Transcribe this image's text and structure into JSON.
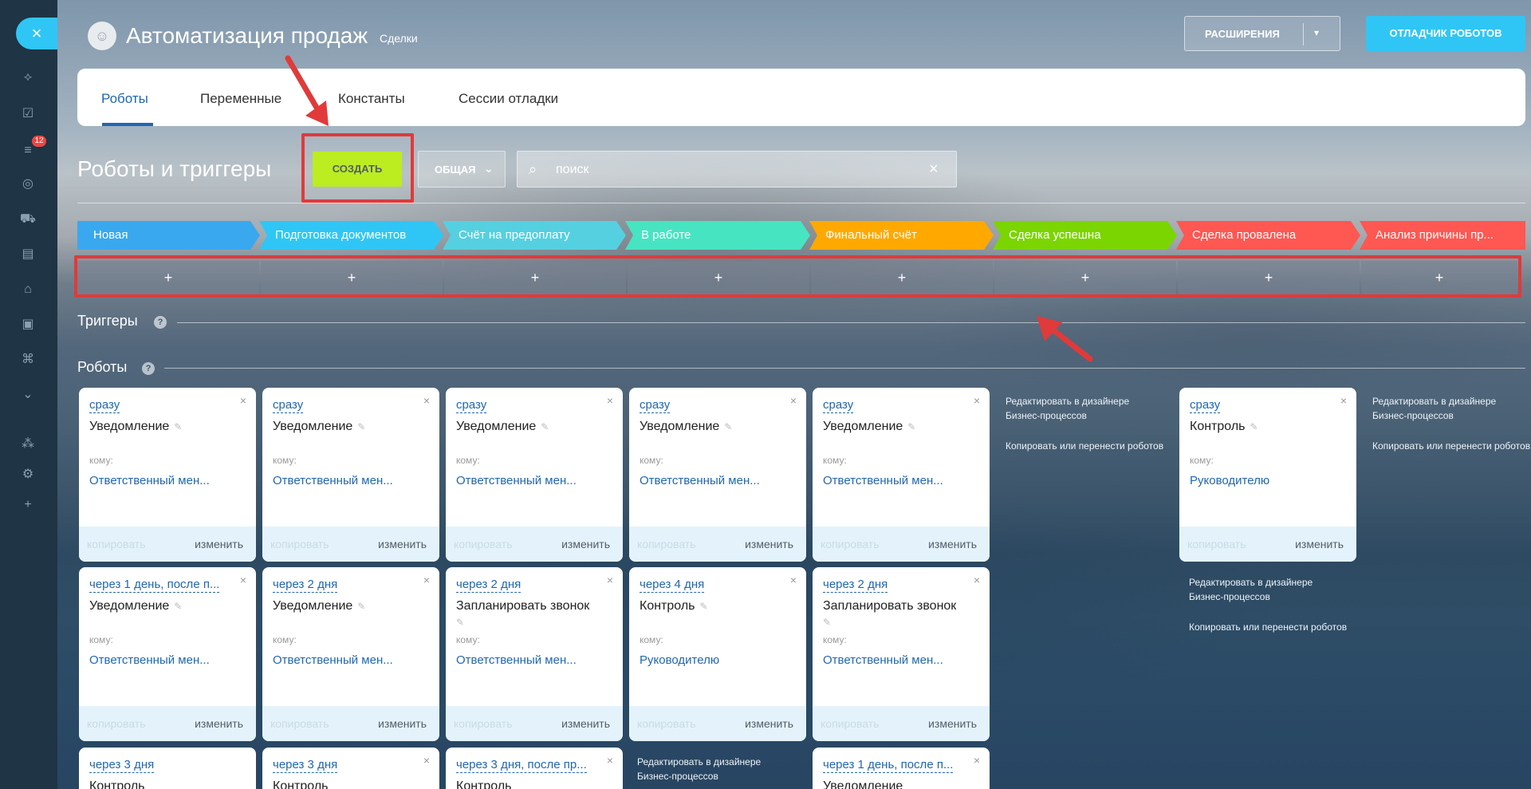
{
  "sidebar": {
    "close_label": "×",
    "badge": "12",
    "icons": [
      "share-icon",
      "task-icon",
      "filter-icon",
      "target-icon",
      "cart-icon",
      "contact-icon",
      "robot-icon",
      "box-icon",
      "store-icon",
      "chevron-down-icon",
      "sitemap-icon",
      "gear-icon",
      "plus-icon"
    ]
  },
  "header": {
    "title": "Автоматизация продаж",
    "crumb": "Сделки",
    "extensions_label": "РАСШИРЕНИЯ",
    "debugger_label": "ОТЛАДЧИК РОБОТОВ"
  },
  "tabs": [
    {
      "label": "Роботы",
      "active": true
    },
    {
      "label": "Переменные",
      "active": false
    },
    {
      "label": "Константы",
      "active": false
    },
    {
      "label": "Сессии отладки",
      "active": false
    }
  ],
  "toolbar": {
    "section_title": "Роботы и триггеры",
    "create_label": "СОЗДАТЬ",
    "general_label": "ОБЩАЯ",
    "search_placeholder": "поиск"
  },
  "stages": [
    {
      "label": "Новая",
      "color": "#39a8ef"
    },
    {
      "label": "Подготовка документов",
      "color": "#2fc6f6"
    },
    {
      "label": "Счёт на предоплату",
      "color": "#55d0e0"
    },
    {
      "label": "В работе",
      "color": "#47e4c2"
    },
    {
      "label": "Финальный счёт",
      "color": "#ffa900"
    },
    {
      "label": "Сделка успешна",
      "color": "#7bd500"
    },
    {
      "label": "Сделка провалена",
      "color": "#ff5752"
    },
    {
      "label": "Анализ причины пр...",
      "color": "#ff5752"
    }
  ],
  "plus_label": "+",
  "triggers_title": "Триггеры",
  "robots_title": "Роботы",
  "card_labels": {
    "komu": "кому:",
    "copy": "копировать",
    "edit": "изменить",
    "close": "×"
  },
  "side_links": {
    "designer": "Редактировать в дизайнере Бизнес-процессов",
    "copy_move": "Копировать или перенести роботов"
  },
  "cards_row1": [
    {
      "when": "сразу",
      "name": "Уведомление",
      "to": "Ответственный мен..."
    },
    {
      "when": "сразу",
      "name": "Уведомление",
      "to": "Ответственный мен..."
    },
    {
      "when": "сразу",
      "name": "Уведомление",
      "to": "Ответственный мен..."
    },
    {
      "when": "сразу",
      "name": "Уведомление",
      "to": "Ответственный мен..."
    },
    {
      "when": "сразу",
      "name": "Уведомление",
      "to": "Ответственный мен..."
    },
    {
      "when": "сразу",
      "name": "Контроль",
      "to": "Руководителю"
    }
  ],
  "cards_row2": [
    {
      "when": "через 1 день, после п...",
      "name": "Уведомление",
      "to": "Ответственный мен..."
    },
    {
      "when": "через 2 дня",
      "name": "Уведомление",
      "to": "Ответственный мен..."
    },
    {
      "when": "через 2 дня",
      "name": "Запланировать звонок",
      "to": "Ответственный мен..."
    },
    {
      "when": "через 4 дня",
      "name": "Контроль",
      "to": "Руководителю"
    },
    {
      "when": "через 2 дня",
      "name": "Запланировать звонок",
      "to": "Ответственный мен..."
    }
  ],
  "cards_row3": [
    {
      "when": "через 3 дня",
      "name": "Контроль"
    },
    {
      "when": "через 3 дня",
      "name": "Контроль"
    },
    {
      "when": "через 3 дня, после пр...",
      "name": "Контроль"
    },
    {
      "when": "через 1 день, после п...",
      "name": "Уведомление"
    }
  ],
  "annotation_color": "#e03a3a"
}
